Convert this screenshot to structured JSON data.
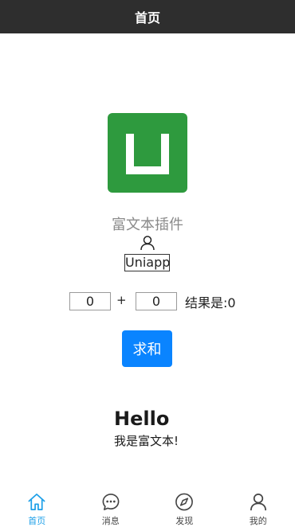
{
  "colors": {
    "nav_bg": "#2e2e2e",
    "logo_green": "#2e9a3e",
    "primary_button": "#0a84ff",
    "tab_active": "#1ea0e8",
    "tab_inactive": "#444444",
    "caption_gray": "#8a8a8a"
  },
  "nav": {
    "title": "首页"
  },
  "main": {
    "logo_icon": "uniapp-logo",
    "caption": "富文本插件",
    "user_icon": "user-icon",
    "username": "Uniapp",
    "calc": {
      "a_value": "0",
      "plus": "+",
      "b_value": "0",
      "result_text": "结果是:0"
    },
    "sum_button_label": "求和",
    "rich_text": {
      "title": "Hello",
      "body": "我是富文本!"
    }
  },
  "tabs": [
    {
      "label": "首页",
      "icon": "home-icon",
      "active": true
    },
    {
      "label": "消息",
      "icon": "message-icon",
      "active": false
    },
    {
      "label": "发现",
      "icon": "compass-icon",
      "active": false
    },
    {
      "label": "我的",
      "icon": "user-icon",
      "active": false
    }
  ]
}
